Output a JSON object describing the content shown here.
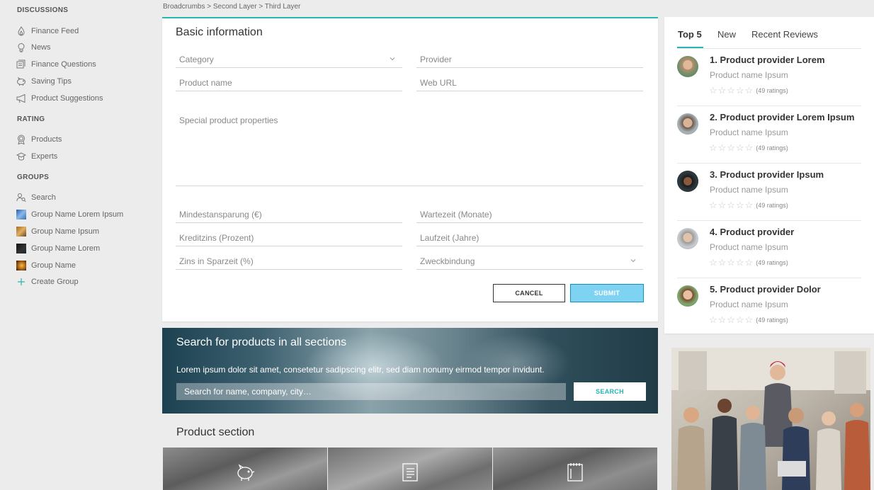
{
  "breadcrumb": "Broadcrumbs > Second Layer > Third Layer",
  "sidebar": {
    "sections": [
      {
        "title": "DISCUSSIONS"
      },
      {
        "title": "RATING"
      },
      {
        "title": "GROUPS"
      }
    ],
    "discussions": [
      {
        "label": "Finance Feed",
        "icon": "flame-icon"
      },
      {
        "label": "News",
        "icon": "lightbulb-icon"
      },
      {
        "label": "Finance Questions",
        "icon": "coins-icon"
      },
      {
        "label": "Saving Tips",
        "icon": "piggy-bank-icon"
      },
      {
        "label": "Product Suggestions",
        "icon": "megaphone-icon"
      }
    ],
    "rating": [
      {
        "label": "Products",
        "icon": "ribbon-icon"
      },
      {
        "label": "Experts",
        "icon": "graduation-icon"
      }
    ],
    "groups": [
      {
        "label": "Search",
        "icon": "people-search-icon"
      },
      {
        "label": "Group Name Lorem Ipsum",
        "icon": "group-thumbnail"
      },
      {
        "label": "Group Name Ipsum",
        "icon": "group-thumbnail"
      },
      {
        "label": "Group Name Lorem",
        "icon": "group-thumbnail"
      },
      {
        "label": "Group Name",
        "icon": "group-thumbnail"
      },
      {
        "label": "Create Group",
        "icon": "plus-icon"
      }
    ]
  },
  "form": {
    "title": "Basic information",
    "category": "Category",
    "provider": "Provider",
    "product_name": "Product name",
    "web_url": "Web URL",
    "special": "Special product properties",
    "mindestansparung": "Mindestansparung (€)",
    "wartezeit": "Wartezeit (Monate)",
    "kreditzins": "Kreditzins (Prozent)",
    "laufzeit": "Laufzeit (Jahre)",
    "zins": "Zins in Sparzeit (%)",
    "zweckbindung": "Zweckbindung",
    "cancel": "CANCEL",
    "submit": "SUBMIT"
  },
  "search_banner": {
    "title": "Search for products in all sections",
    "text": "Lorem ipsum dolor sit amet, consetetur sadipscing elitr, sed diam nonumy eirmod tempor invidunt.",
    "placeholder": "Search for name, company, city…",
    "button": "SEARCH"
  },
  "product_section": {
    "title": "Product section",
    "tiles": [
      {
        "icon": "piggy-bank-icon"
      },
      {
        "icon": "document-list-icon"
      },
      {
        "icon": "notebook-icon"
      }
    ]
  },
  "top_panel": {
    "tabs": [
      "Top 5",
      "New",
      "Recent Reviews"
    ],
    "active_tab": "Top 5",
    "items": [
      {
        "title": "1. Product provider Lorem",
        "sub": "Product name Ipsum",
        "ratings": "(49 ratings)",
        "stars": 0
      },
      {
        "title": "2. Product provider Lorem Ipsum",
        "sub": "Product name Ipsum",
        "ratings": "(49 ratings)",
        "stars": 0
      },
      {
        "title": "3. Product provider Ipsum",
        "sub": "Product name Ipsum",
        "ratings": "(49 ratings)",
        "stars": 0
      },
      {
        "title": "4. Product provider",
        "sub": "Product name Ipsum",
        "ratings": "(49 ratings)",
        "stars": 0
      },
      {
        "title": "5. Product provider Dolor",
        "sub": "Product name Ipsum",
        "ratings": "(49 ratings)",
        "stars": 0
      }
    ]
  },
  "colors": {
    "accent": "#2ab5b3",
    "submit_bg": "#7ed3f3",
    "submit_border": "#0a92c4"
  }
}
